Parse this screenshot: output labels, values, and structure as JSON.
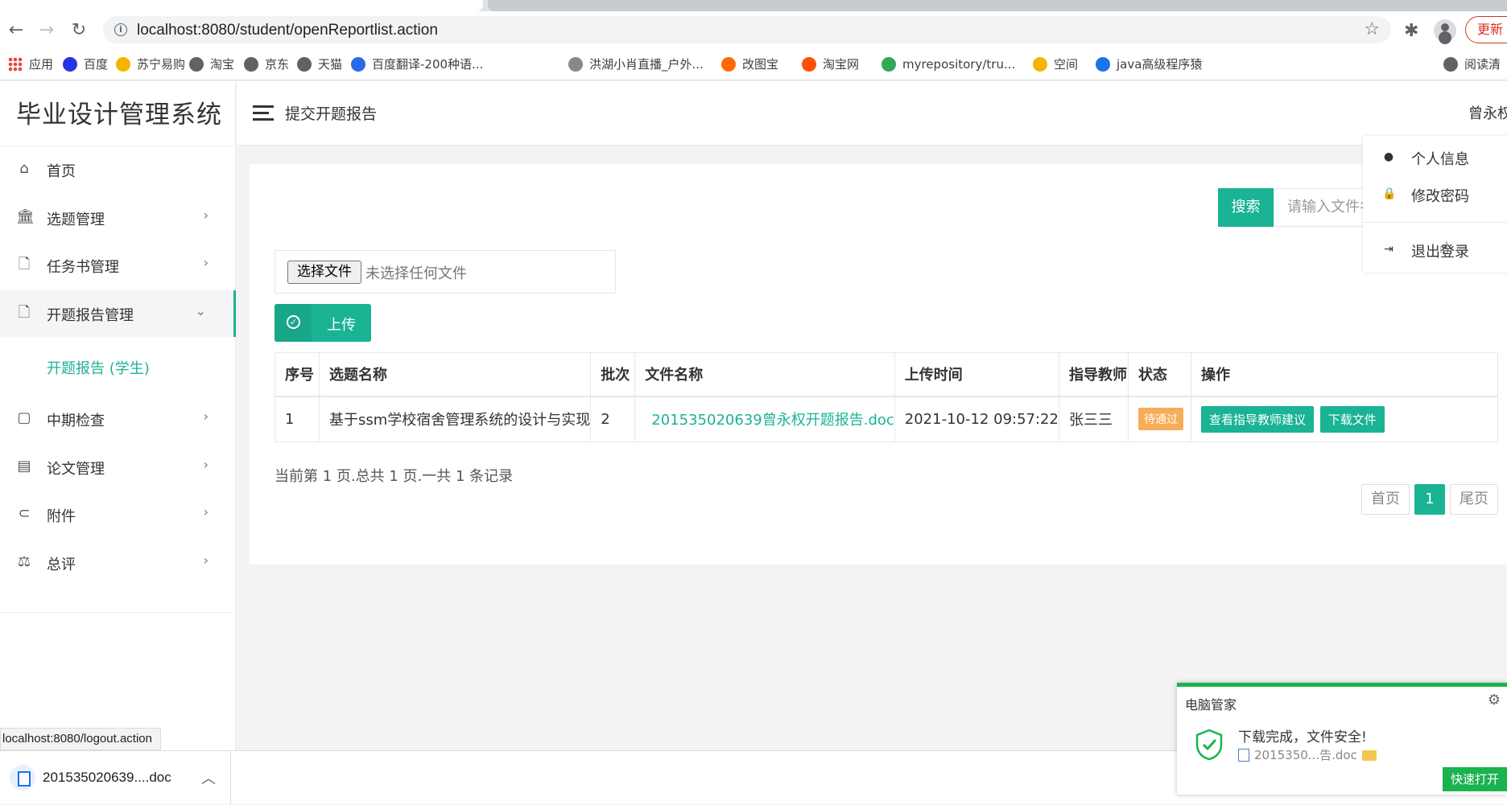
{
  "browser": {
    "url": "localhost:8080/student/openReportlist.action",
    "update_label": "更新",
    "bookmarks": [
      {
        "label": "应用",
        "color": "#ea4335"
      },
      {
        "label": "百度",
        "color": "#2932e1"
      },
      {
        "label": "苏宁易购",
        "color": "#f5b400"
      },
      {
        "label": "淘宝",
        "color": "#5f6368"
      },
      {
        "label": "京东",
        "color": "#5f6368"
      },
      {
        "label": "天猫",
        "color": "#5f6368"
      },
      {
        "label": "百度翻译-200种语...",
        "color": "#2a6ae8"
      },
      {
        "label": "洪湖小肖直播_户外...",
        "color": "#888888"
      },
      {
        "label": "改图宝",
        "color": "#ff6a00"
      },
      {
        "label": "淘宝网",
        "color": "#ff5000"
      },
      {
        "label": "myrepository/tru...",
        "color": "#34a853"
      },
      {
        "label": "空间",
        "color": "#f4b400"
      },
      {
        "label": "java高级程序猿",
        "color": "#1a73e8"
      },
      {
        "label": "阅读清",
        "color": "#5f6368"
      }
    ]
  },
  "sidebar": {
    "brand": "毕业设计管理系统",
    "items": [
      {
        "label": "首页",
        "icon": "home-icon",
        "glyph": "⌂"
      },
      {
        "label": "选题管理",
        "icon": "bank-icon",
        "glyph": "🏛"
      },
      {
        "label": "任务书管理",
        "icon": "file-icon",
        "glyph": "🗋"
      },
      {
        "label": "开题报告管理",
        "icon": "file-icon",
        "glyph": "🗋"
      },
      {
        "label": "中期检查",
        "icon": "book-icon",
        "glyph": "▢"
      },
      {
        "label": "论文管理",
        "icon": "file-text-icon",
        "glyph": "▤"
      },
      {
        "label": "附件",
        "icon": "paperclip-icon",
        "glyph": "⊂"
      },
      {
        "label": "总评",
        "icon": "balance-scale-icon",
        "glyph": "⚖"
      }
    ],
    "submenu_active": "开题报告 (学生)"
  },
  "header": {
    "title": "提交开题报告",
    "user": "曾永权"
  },
  "dropdown": {
    "items": [
      "个人信息",
      "修改密码",
      "退出登录"
    ]
  },
  "search": {
    "button": "搜索",
    "placeholder": "请输入文件名"
  },
  "upload": {
    "choose_label": "选择文件",
    "no_file_text": "未选择任何文件",
    "button": "上传"
  },
  "table": {
    "headers": [
      "序号",
      "选题名称",
      "批次",
      "文件名称",
      "上传时间",
      "指导教师",
      "状态",
      "操作"
    ],
    "rows": [
      {
        "no": "1",
        "topic": "基于ssm学校宿舍管理系统的设计与实现",
        "batch": "2",
        "file": "201535020639曾永权开题报告.doc",
        "time": "2021-10-12 09:57:22",
        "teacher": "张三三",
        "status": "待通过",
        "actions": [
          "查看指导教师建议",
          "下载文件"
        ]
      }
    ]
  },
  "pagination": {
    "summary": "当前第 1 页.总共 1 页.一共 1 条记录",
    "first": "首页",
    "current": "1",
    "last": "尾页"
  },
  "status_url": "localhost:8080/logout.action",
  "download": {
    "filename": "201535020639....doc"
  },
  "notification": {
    "title": "电脑管家",
    "message": "下载完成，文件安全!",
    "file": "2015350...告.doc",
    "open_button": "快速打开"
  },
  "colors": {
    "accent": "#1ab394",
    "warning": "#f8ac59",
    "notify_green": "#1ab34f"
  }
}
